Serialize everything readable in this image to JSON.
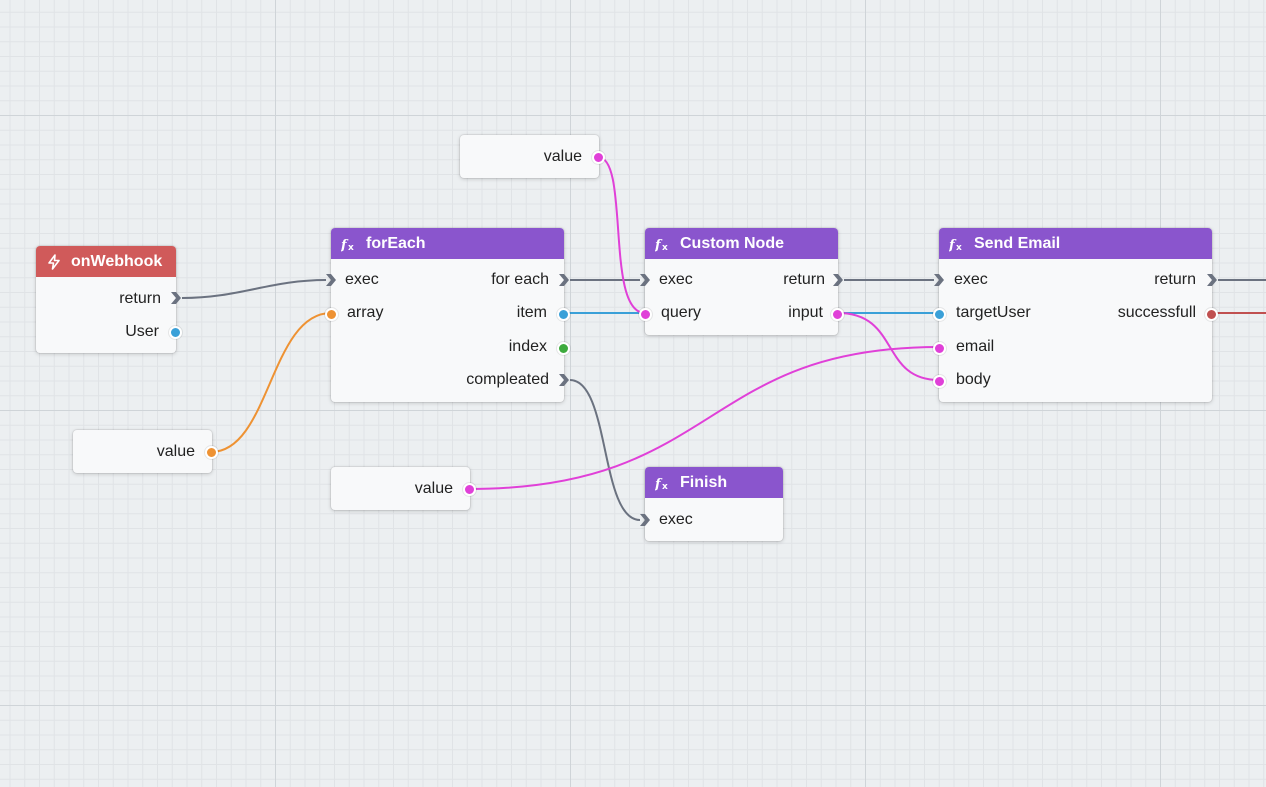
{
  "colors": {
    "exec": "#6b7280",
    "string": "#e040d8",
    "object": "#3aa0d8",
    "number": "#3daa3d",
    "array": "#ee9233",
    "boolean": "#c05050",
    "function_header": "#8a55cd",
    "event_header": "#d05a5a"
  },
  "nodes": {
    "onwebhook": {
      "title": "onWebhook",
      "icon": "lightning-icon",
      "outputs": [
        "return",
        "User"
      ]
    },
    "foreach": {
      "title": "forEach",
      "icon": "function-icon",
      "inputs": [
        "exec",
        "array"
      ],
      "outputs": [
        "for each",
        "item",
        "index",
        "compleated"
      ]
    },
    "custom": {
      "title": "Custom Node",
      "icon": "function-icon",
      "inputs": [
        "exec",
        "query"
      ],
      "outputs": [
        "return",
        "input"
      ]
    },
    "sendemail": {
      "title": "Send Email",
      "icon": "function-icon",
      "inputs": [
        "exec",
        "targetUser",
        "email",
        "body"
      ],
      "outputs": [
        "return",
        "successfull"
      ]
    },
    "finish": {
      "title": "Finish",
      "icon": "function-icon",
      "inputs": [
        "exec"
      ]
    }
  },
  "literals": {
    "top": "value",
    "left": "value",
    "bottom": "value"
  }
}
